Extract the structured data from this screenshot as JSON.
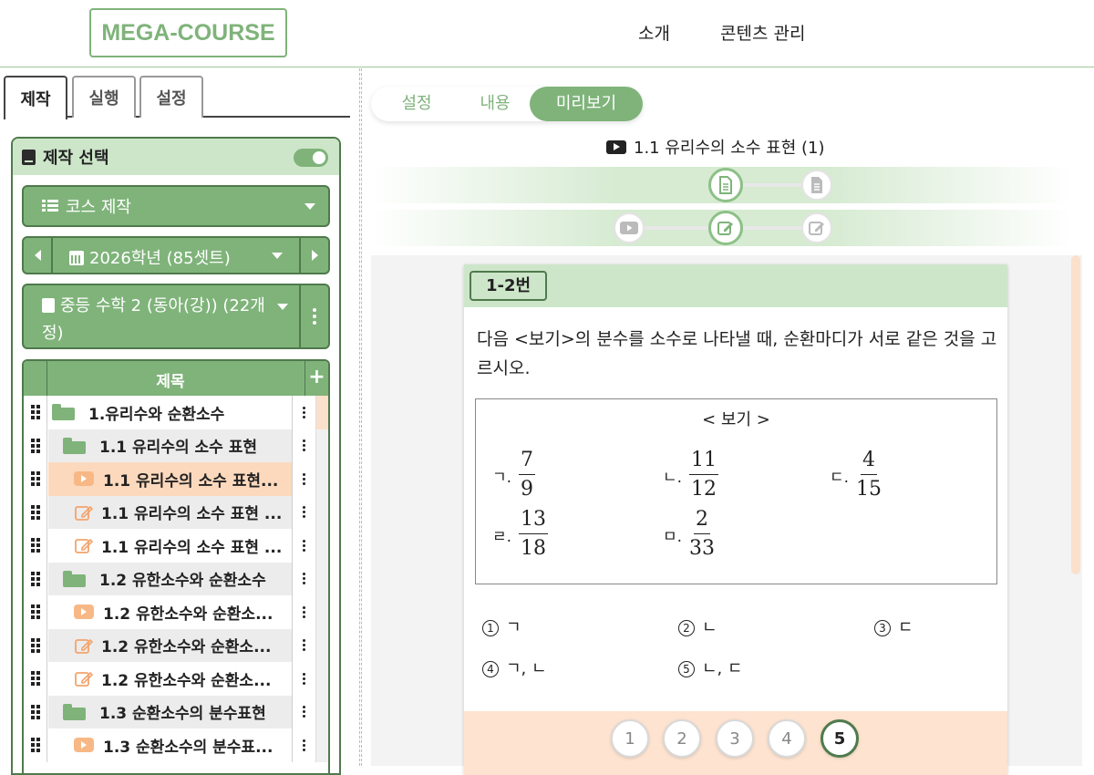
{
  "header": {
    "logo": "MEGA-COURSE",
    "nav": [
      "소개",
      "콘텐츠 관리"
    ]
  },
  "left": {
    "tabs": [
      "제작",
      "실행",
      "설정"
    ],
    "panel_title": "제작 선택",
    "course_make": "코스 제작",
    "year": "2026학년 (85셋트)",
    "textbook": "중등 수학 2 (동아(강)) (22개정)",
    "tree_header": "제목",
    "tree_add": "+",
    "rows": [
      {
        "type": "folder",
        "label": "1.유리수와 순환소수"
      },
      {
        "type": "folder",
        "label": "1.1 유리수의 소수 표현"
      },
      {
        "type": "video",
        "label": "1.1 유리수의 소수 표현..."
      },
      {
        "type": "pen",
        "label": "1.1 유리수의 소수 표현 ..."
      },
      {
        "type": "pen",
        "label": "1.1 유리수의 소수 표현 ..."
      },
      {
        "type": "folder",
        "label": "1.2 유한소수와 순환소수"
      },
      {
        "type": "video",
        "label": "1.2 유한소수와 순환소..."
      },
      {
        "type": "pen",
        "label": "1.2 유한소수와 순환소..."
      },
      {
        "type": "pen",
        "label": "1.2 유한소수와 순환소..."
      },
      {
        "type": "folder",
        "label": "1.3 순환소수의 분수표현"
      },
      {
        "type": "video",
        "label": "1.3 순환소수의 분수표..."
      }
    ]
  },
  "right": {
    "mode_tabs": [
      "설정",
      "내용",
      "미리보기"
    ],
    "lesson_title": "1.1 유리수의 소수 표현 (1)",
    "question": {
      "number": "1-2번",
      "text": "다음 <보기>의 분수를 소수로 나타낼 때, 순환마디가 서로 같은 것을 고르시오.",
      "bogi_title": "< 보기 >",
      "items": [
        {
          "label": "ㄱ.",
          "num": "7",
          "den": "9"
        },
        {
          "label": "ㄴ.",
          "num": "11",
          "den": "12"
        },
        {
          "label": "ㄷ.",
          "num": "4",
          "den": "15"
        },
        {
          "label": "ㄹ.",
          "num": "13",
          "den": "18"
        },
        {
          "label": "ㅁ.",
          "num": "2",
          "den": "33"
        }
      ],
      "choices": [
        {
          "no": "1",
          "text": "ㄱ"
        },
        {
          "no": "2",
          "text": "ㄴ"
        },
        {
          "no": "3",
          "text": "ㄷ"
        },
        {
          "no": "4",
          "text": "ㄱ, ㄴ"
        },
        {
          "no": "5",
          "text": "ㄴ, ㄷ"
        }
      ],
      "answer_buttons": [
        "1",
        "2",
        "3",
        "4",
        "5"
      ],
      "selected_answer": "5"
    }
  },
  "colors": {
    "accent": "#7fb37a",
    "accent_dark": "#4f7a4c",
    "accent_light": "#cde6c9",
    "selected_row": "#fcd9bd",
    "answer_bar": "#fde3d0"
  }
}
